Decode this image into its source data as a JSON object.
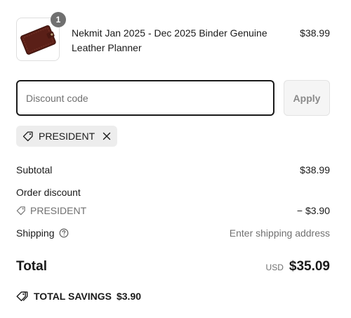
{
  "product": {
    "name": "Nekmit Jan 2025 - Dec 2025 Binder Genuine Leather Planner",
    "price": "$38.99",
    "quantity": "1",
    "thumbnail_icon": "leather-planner-image"
  },
  "discount": {
    "placeholder": "Discount code",
    "value": "",
    "apply_label": "Apply"
  },
  "applied_code": {
    "code": "PRESIDENT",
    "tag_icon": "tag-icon",
    "remove_icon": "close-icon"
  },
  "summary": {
    "subtotal_label": "Subtotal",
    "subtotal_value": "$38.99",
    "order_discount_label": "Order discount",
    "discount_code": "PRESIDENT",
    "discount_value": "− $3.90",
    "shipping_label": "Shipping",
    "shipping_value": "Enter shipping address",
    "total_label": "Total",
    "currency": "USD",
    "total_value": "$35.09",
    "savings_label": "TOTAL SAVINGS",
    "savings_value": "$3.90"
  }
}
